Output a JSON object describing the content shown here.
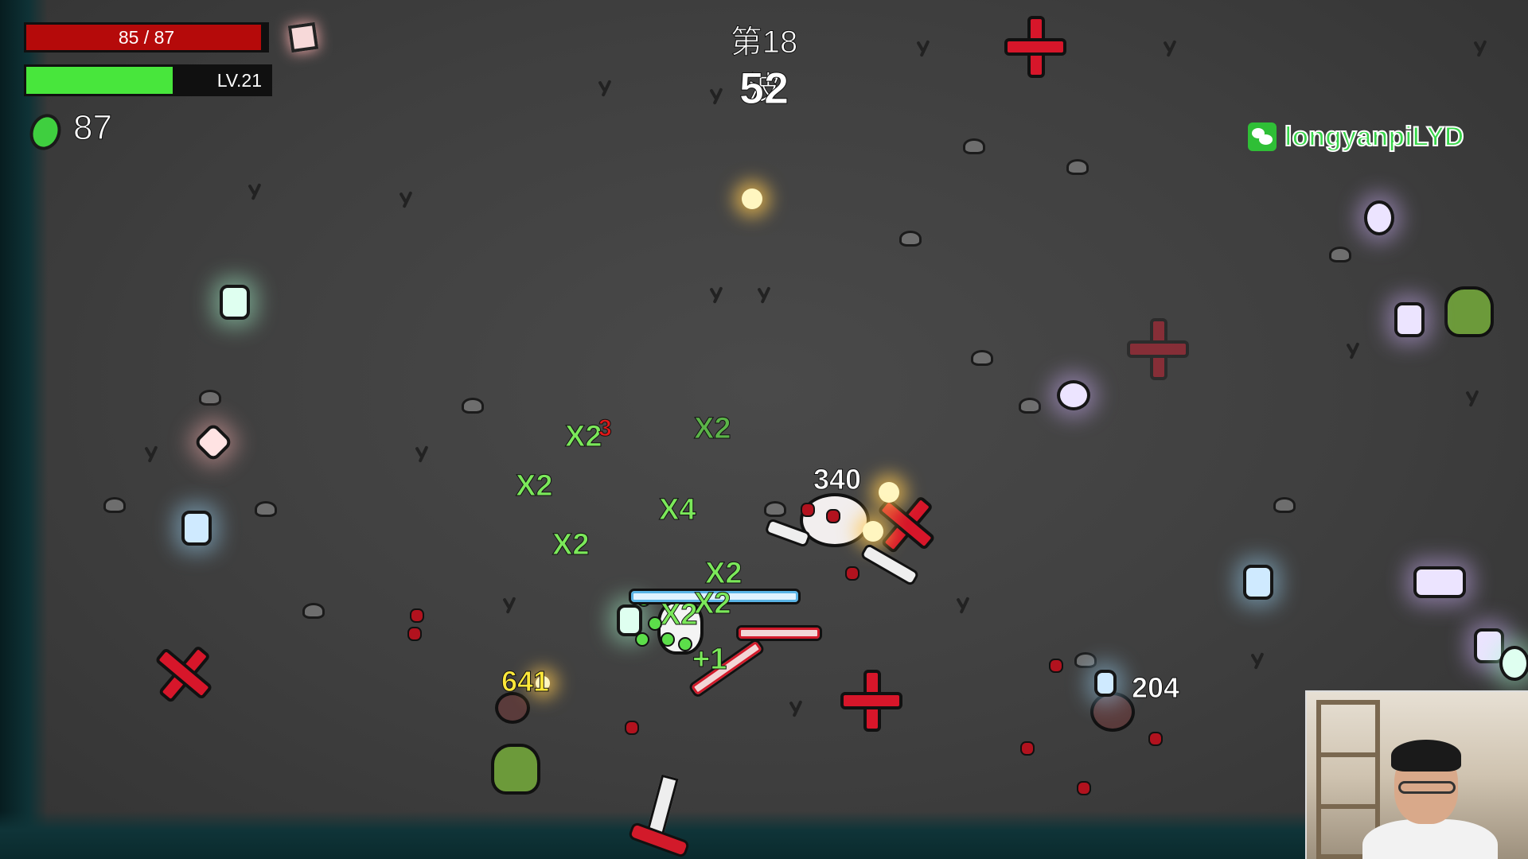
{
  "hud": {
    "hp_text": "85 / 87",
    "hp_current": 85,
    "hp_max": 87,
    "level_text": "LV.21",
    "xp_fraction": 0.6,
    "currency_count": "87"
  },
  "wave": {
    "title": "第18波",
    "timer": "52"
  },
  "watermark": {
    "handle": "longyanpiLYD"
  },
  "floating_text": {
    "x2_a": "X2",
    "x2_b": "X2",
    "x2_c": "X2",
    "x2_d": "X2",
    "x2_e": "X2",
    "x2_f": "X2",
    "x2_g": "X2",
    "x4": "X4",
    "plus_one": "+1",
    "red_3": "3",
    "damage_340": "340",
    "damage_204": "204",
    "damage_641": "641"
  },
  "colors": {
    "hp": "#b50a0a",
    "xp": "#48e63c",
    "currency": "#3fcf3f",
    "enemy_cross": "#d7162a",
    "watermark": "#38d64a"
  },
  "icons": {
    "currency": "green-material-icon",
    "item": "pink-crate-icon",
    "watermark": "wechat-icon"
  }
}
